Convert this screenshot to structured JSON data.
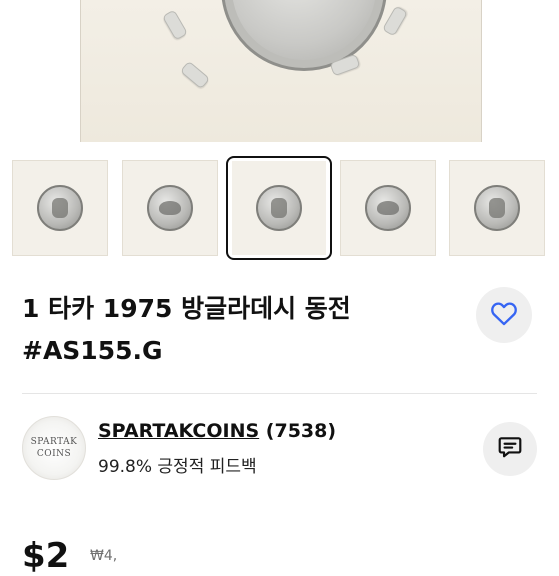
{
  "listing": {
    "title_line1": "1 타카 1975 방글라데시 동전",
    "title_line2": "#AS155.G"
  },
  "seller": {
    "logo_line1": "SPARTAK",
    "logo_line2": "COINS",
    "name": "SPARTAKCOINS",
    "rating_count": "(7538)",
    "feedback": "99.8% 긍정적 피드백"
  },
  "price": {
    "amount": "$2",
    "sub": "₩4,"
  },
  "thumbnails": {
    "count": 5,
    "selected_index": 2
  },
  "icons": {
    "watch": "heart-icon",
    "message": "message-icon"
  },
  "colors": {
    "accent": "#3665f3",
    "button_bg": "#efefef",
    "selected_border": "#111111"
  }
}
